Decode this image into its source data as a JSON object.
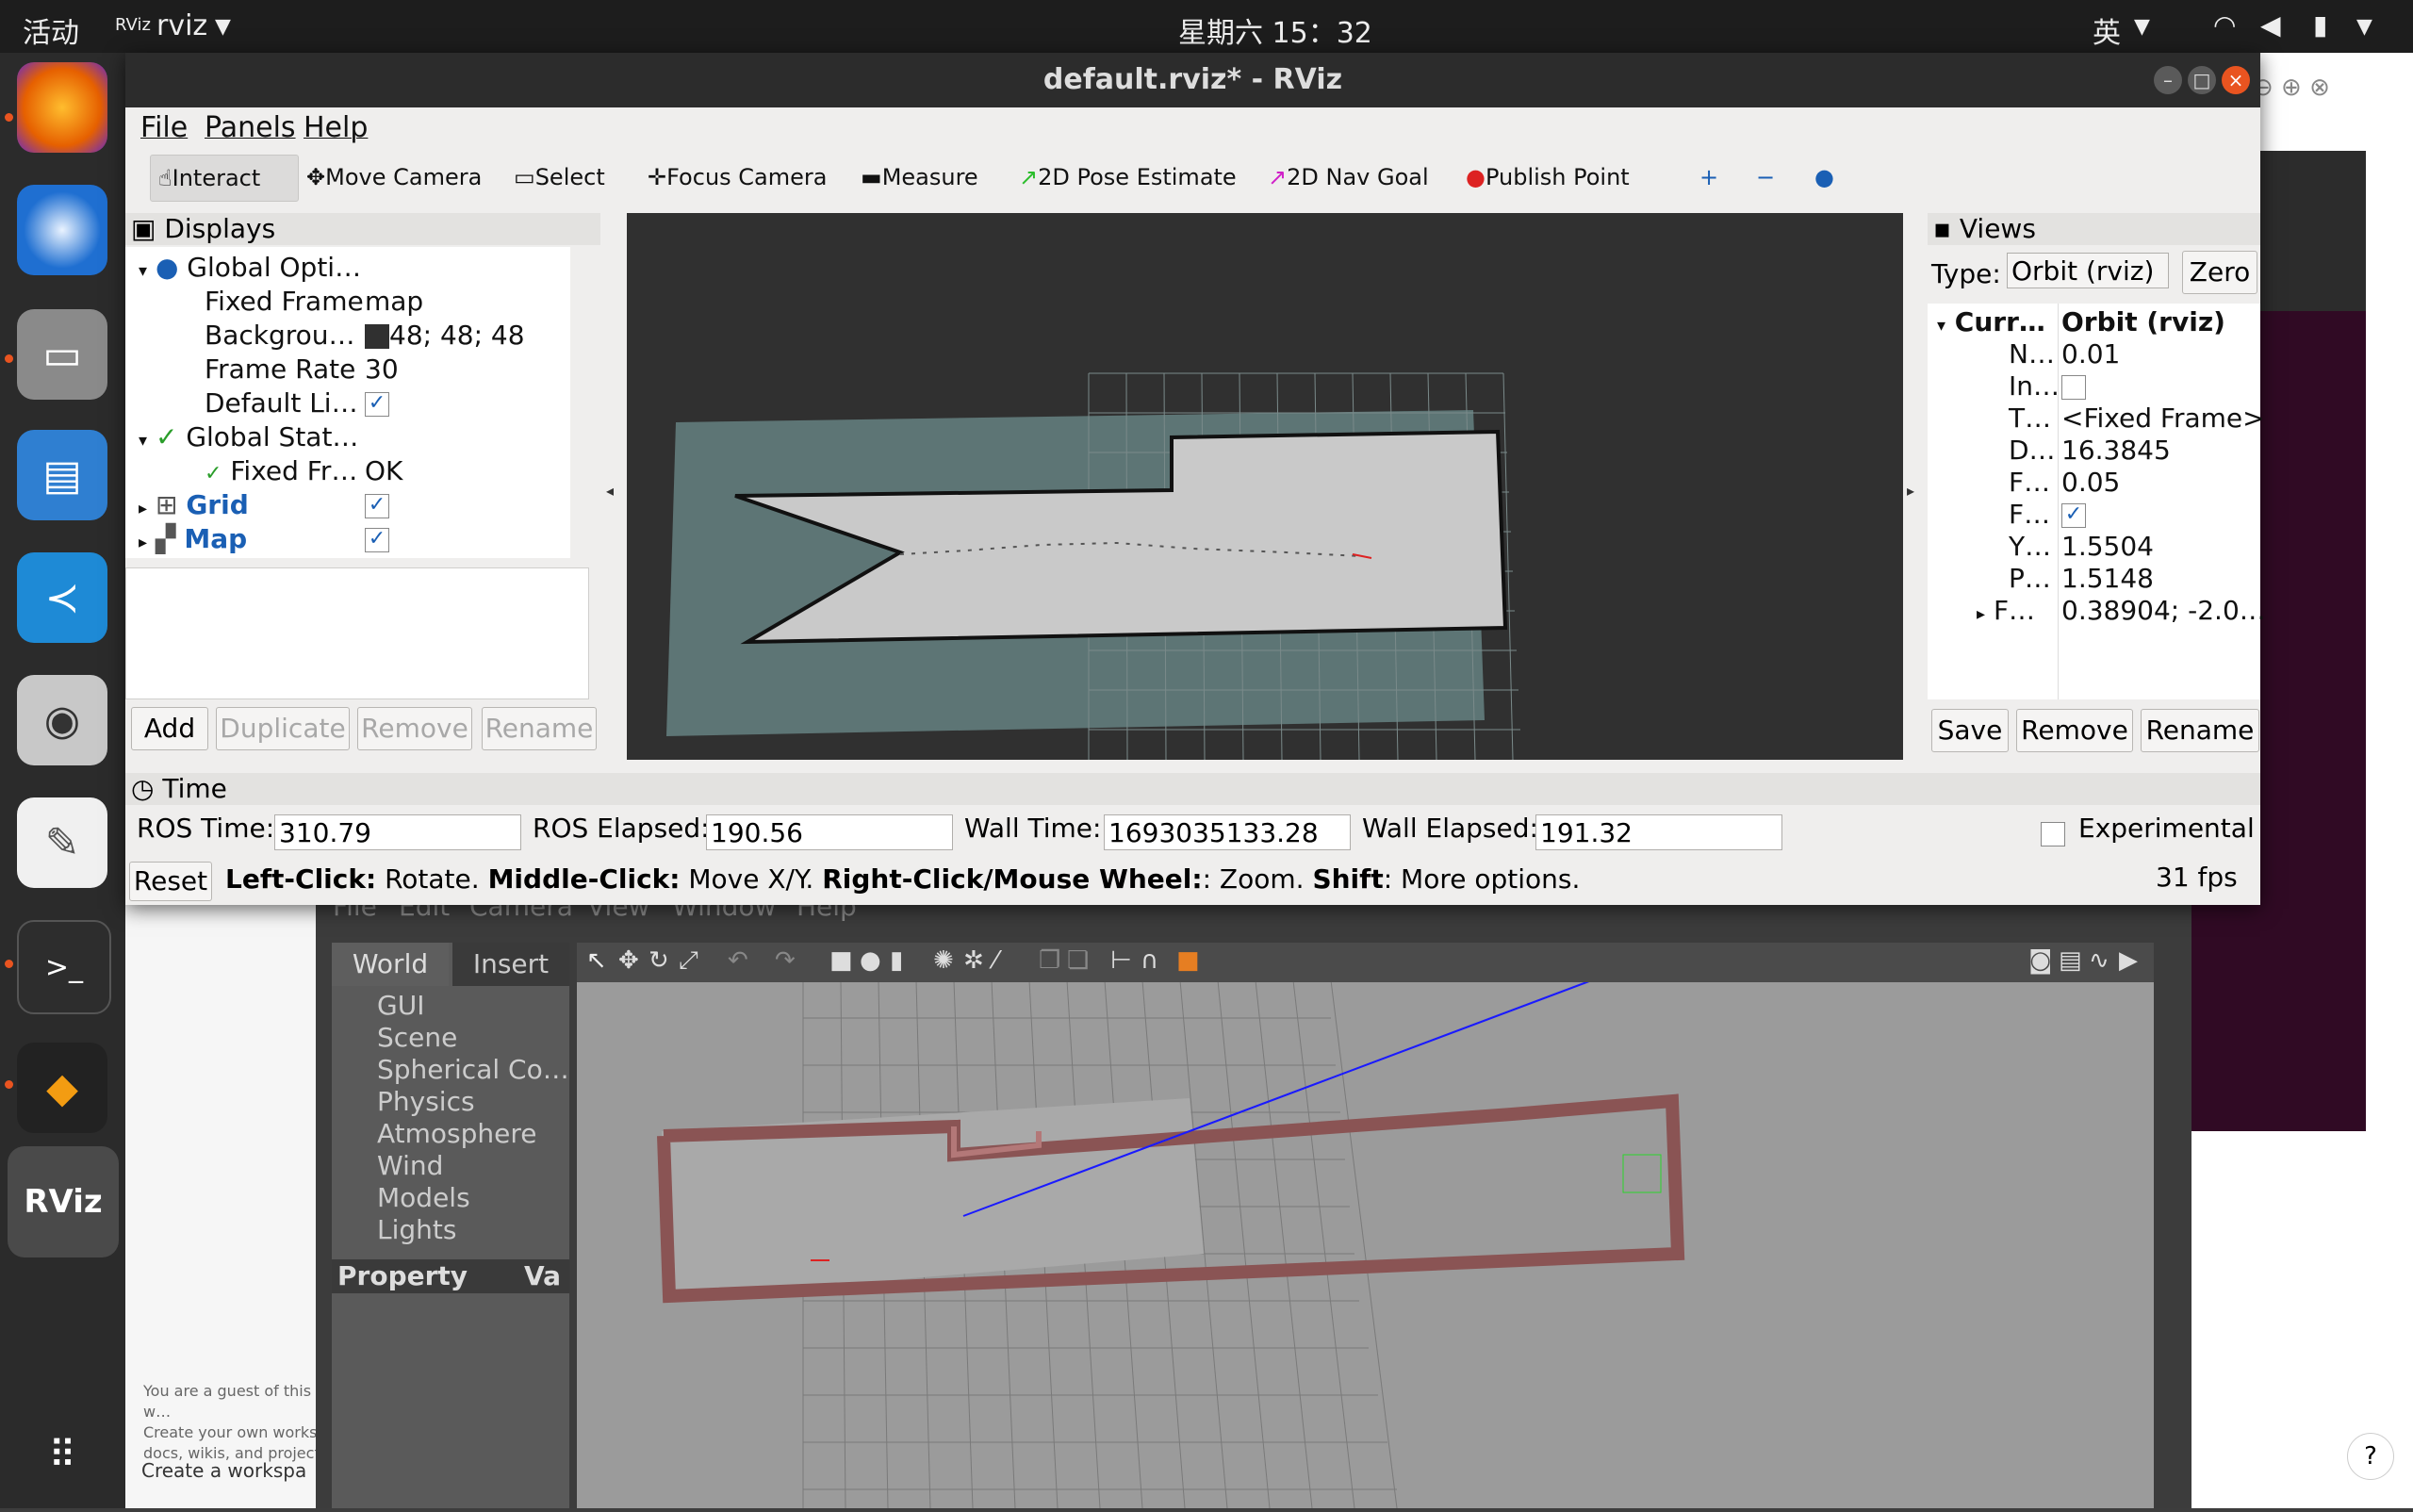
{
  "topbar": {
    "activities": "活动",
    "app_name": "rviz",
    "clock": "星期六 15：32",
    "input_method": "英"
  },
  "rviz": {
    "title": "default.rviz* - RViz",
    "menu": [
      "File",
      "Panels",
      "Help"
    ],
    "tools": [
      "Interact",
      "Move Camera",
      "Select",
      "Focus Camera",
      "Measure",
      "2D Pose Estimate",
      "2D Nav Goal",
      "Publish Point"
    ],
    "displays": {
      "title": "Displays",
      "rows": [
        {
          "label": "Global Opti…",
          "value": ""
        },
        {
          "label": "Fixed Frame",
          "value": "map"
        },
        {
          "label": "Backgrou…",
          "value": "48; 48; 48"
        },
        {
          "label": "Frame Rate",
          "value": "30"
        },
        {
          "label": "Default Li…",
          "value": "✓"
        },
        {
          "label": "Global Stat…",
          "value": ""
        },
        {
          "label": "Fixed Fr…",
          "value": "OK"
        },
        {
          "label": "Grid",
          "value": "✓"
        },
        {
          "label": "Map",
          "value": "✓"
        }
      ],
      "buttons": [
        "Add",
        "Duplicate",
        "Remove",
        "Rename"
      ]
    },
    "views": {
      "title": "Views",
      "type_label": "Type:",
      "type_value": "Orbit (rviz)",
      "zero": "Zero",
      "rows": [
        {
          "label": "Curr…",
          "value": "Orbit (rviz)"
        },
        {
          "label": "N…",
          "value": "0.01"
        },
        {
          "label": "In…",
          "value": ""
        },
        {
          "label": "T…",
          "value": "<Fixed Frame>"
        },
        {
          "label": "D…",
          "value": "16.3845"
        },
        {
          "label": "F…",
          "value": "0.05"
        },
        {
          "label": "F…",
          "value": "✓"
        },
        {
          "label": "Y…",
          "value": "1.5504"
        },
        {
          "label": "P…",
          "value": "1.5148"
        },
        {
          "label": "F…",
          "value": "0.38904; -2.0…"
        }
      ],
      "buttons": [
        "Save",
        "Remove",
        "Rename"
      ]
    },
    "time": {
      "title": "Time",
      "ros_time_label": "ROS Time:",
      "ros_time": "310.79",
      "ros_elapsed_label": "ROS Elapsed:",
      "ros_elapsed": "190.56",
      "wall_time_label": "Wall Time:",
      "wall_time": "1693035133.28",
      "wall_elapsed_label": "Wall Elapsed:",
      "wall_elapsed": "191.32",
      "experimental": "Experimental"
    },
    "status": {
      "reset": "Reset",
      "left": "Left-Click:",
      "left_t": " Rotate. ",
      "middle": "Middle-Click:",
      "middle_t": " Move X/Y. ",
      "right": "Right-Click/Mouse Wheel:",
      "right_t": ": Zoom. ",
      "shift": "Shift",
      "shift_t": ": More options.",
      "fps": "31 fps"
    }
  },
  "gazebo": {
    "menu": [
      "File",
      "Edit",
      "Camera",
      "View",
      "Window",
      "Help"
    ],
    "tabs": [
      "World",
      "Insert"
    ],
    "tree": [
      "GUI",
      "Scene",
      "Spherical Co…",
      "Physics",
      "Atmosphere",
      "Wind",
      "Models",
      "Lights"
    ],
    "property": "Property",
    "value": "Va"
  },
  "bg_text": {
    "guest": "You are a guest of this w…",
    "create": "Create your own works",
    "docs": "docs, wikis, and project",
    "workspace": "Create a workspa",
    "help": "?"
  }
}
